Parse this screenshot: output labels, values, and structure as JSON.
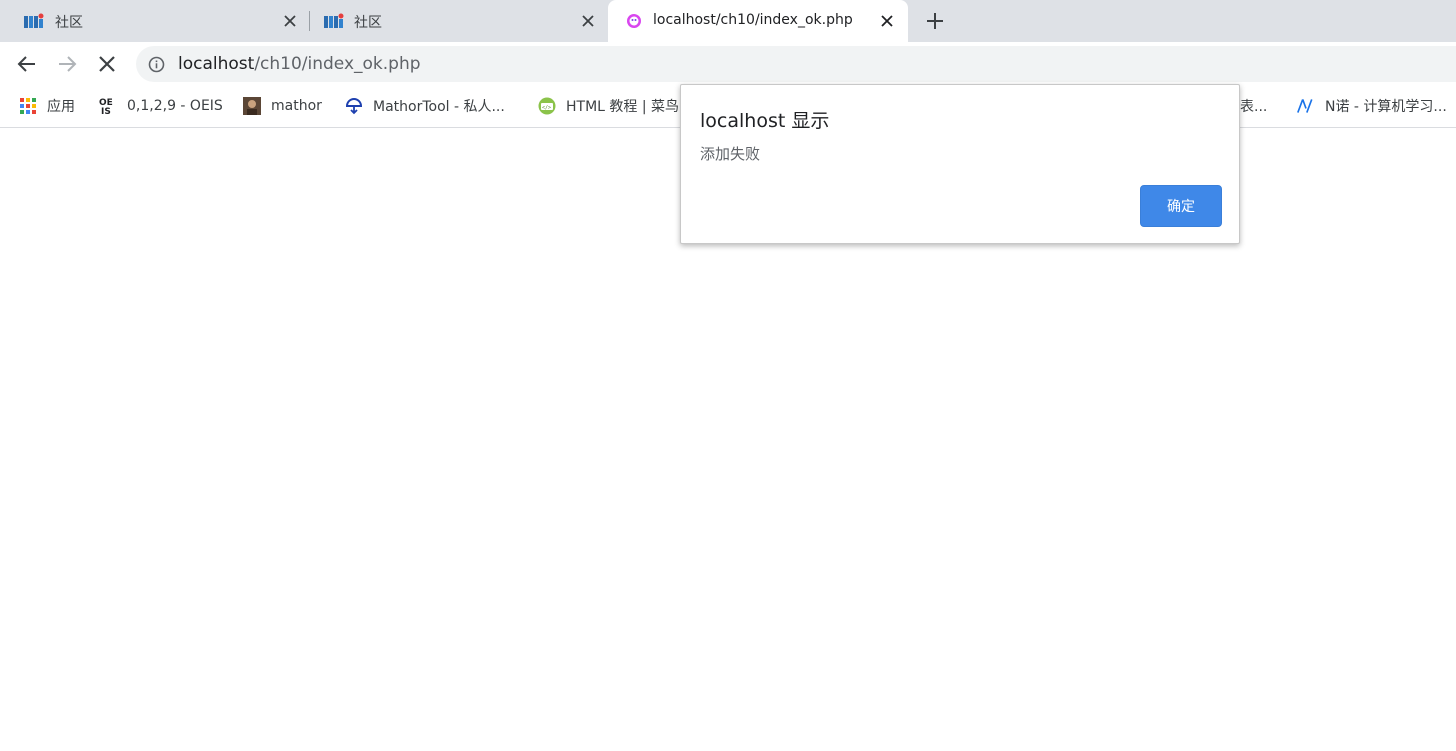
{
  "tabs": [
    {
      "title": "社区",
      "favicon": "community-logo-icon",
      "active": false
    },
    {
      "title": "社区",
      "favicon": "community-logo-icon",
      "active": false
    },
    {
      "title": "localhost/ch10/index_ok.php",
      "favicon": "page-favicon-icon",
      "active": true
    }
  ],
  "toolbar": {
    "url_host": "localhost",
    "url_path": "/ch10/index_ok.php"
  },
  "bookmarks": [
    {
      "label": "应用",
      "icon": "apps-grid-icon"
    },
    {
      "label": "0,1,2,9 - OEIS",
      "icon": "oeis-icon"
    },
    {
      "label": "mathor",
      "icon": "avatar-icon"
    },
    {
      "label": "MathorTool - 私人...",
      "icon": "cloud-icon"
    },
    {
      "label": "HTML 教程 | 菜鸟",
      "icon": "runoob-icon"
    },
    {
      "label": "表...",
      "icon": ""
    },
    {
      "label": "N诺 - 计算机学习...",
      "icon": "nnuo-icon"
    }
  ],
  "dialog": {
    "title": "localhost 显示",
    "message": "添加失败",
    "ok_label": "确定"
  },
  "colors": {
    "tabstrip_bg": "#dee1e6",
    "omnibox_bg": "#f1f3f4",
    "dialog_button": "#3f88e8"
  }
}
